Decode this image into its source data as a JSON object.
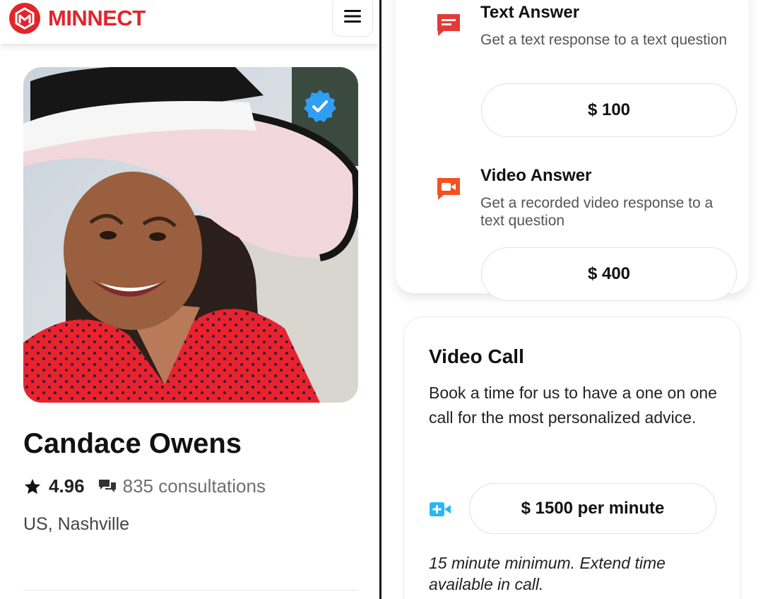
{
  "brand": {
    "name": "MINNECT",
    "color": "#e0252b"
  },
  "header": {
    "menu_icon": "hamburger-icon"
  },
  "profile": {
    "name": "Candace Owens",
    "rating": "4.96",
    "consultations": "835 consultations",
    "location": "US, Nashville",
    "verified_icon": "verified-badge-icon"
  },
  "services": {
    "text_answer": {
      "title": "Text Answer",
      "description": "Get a text response to a text question",
      "price": "$ 100",
      "icon": "text-message-icon",
      "icon_color": "#e53935"
    },
    "video_answer": {
      "title": "Video Answer",
      "description": "Get a recorded video response to a text question",
      "price": "$ 400",
      "icon": "video-message-icon",
      "icon_color": "#f4511e"
    }
  },
  "video_call": {
    "title": "Video Call",
    "description": "Book a time for us to have a one on one call for the most personalized advice.",
    "price": "$ 1500 per minute",
    "note": "15 minute minimum. Extend time available in call.",
    "icon": "video-call-icon",
    "icon_color": "#29b6f6"
  }
}
